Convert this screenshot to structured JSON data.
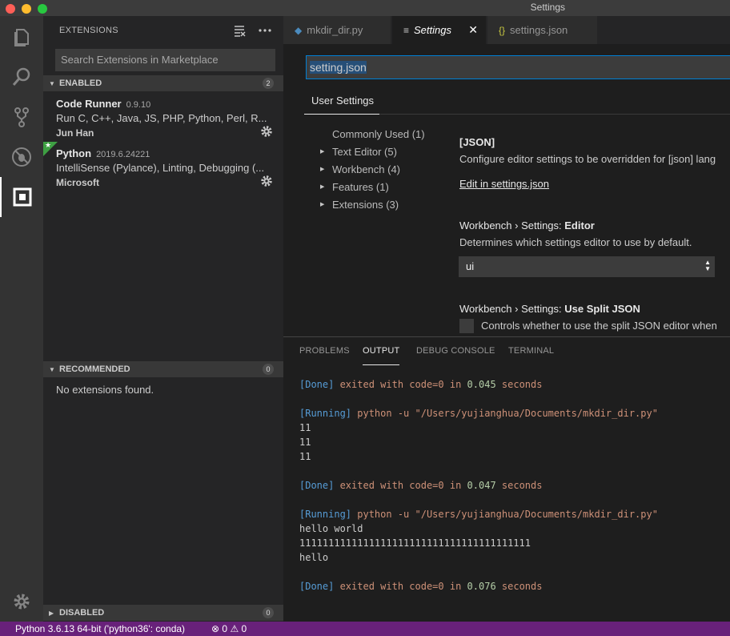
{
  "window": {
    "title": "Settings"
  },
  "sidebar": {
    "header": "EXTENSIONS",
    "search_placeholder": "Search Extensions in Marketplace",
    "enabled": {
      "label": "ENABLED",
      "count": "2",
      "items": [
        {
          "name": "Code Runner",
          "version": "0.9.10",
          "description": "Run C, C++, Java, JS, PHP, Python, Perl, R...",
          "publisher": "Jun Han"
        },
        {
          "name": "Python",
          "version": "2019.6.24221",
          "description": "IntelliSense (Pylance), Linting, Debugging (...",
          "publisher": "Microsoft"
        }
      ]
    },
    "recommended": {
      "label": "RECOMMENDED",
      "count": "0",
      "empty_text": "No extensions found."
    },
    "disabled": {
      "label": "DISABLED",
      "count": "0"
    }
  },
  "tabs": [
    {
      "label": "mkdir_dir.py",
      "icon": "python-file-icon"
    },
    {
      "label": "Settings",
      "icon": "settings-lines-icon",
      "active": true
    },
    {
      "label": "settings.json",
      "icon": "json-braces-icon"
    }
  ],
  "settings": {
    "search_value": "setting.json",
    "scope_tab": "User Settings",
    "toc": [
      {
        "label": "Commonly Used (1)",
        "expandable": false
      },
      {
        "label": "Text Editor (5)",
        "expandable": true
      },
      {
        "label": "Workbench (4)",
        "expandable": true
      },
      {
        "label": "Features (1)",
        "expandable": true
      },
      {
        "label": "Extensions (3)",
        "expandable": true
      }
    ],
    "json_section": {
      "title": "[JSON]",
      "description": "Configure editor settings to be overridden for [json] lang",
      "link": "Edit in settings.json"
    },
    "editor_setting": {
      "prefix": "Workbench › Settings: ",
      "name": "Editor",
      "description": "Determines which settings editor to use by default.",
      "value": "ui"
    },
    "split_setting": {
      "prefix": "Workbench › Settings: ",
      "name": "Use Split JSON",
      "description": "Controls whether to use the split JSON editor when"
    }
  },
  "panel": {
    "tabs": [
      "PROBLEMS",
      "OUTPUT",
      "DEBUG CONSOLE",
      "TERMINAL"
    ],
    "active_tab": "OUTPUT",
    "output": {
      "done1": {
        "tag": "[Done]",
        "text": " exited with ",
        "code": "code=0",
        "in": " in ",
        "secs": "0.045",
        "unit": " seconds"
      },
      "run1": {
        "tag": "[Running]",
        "cmd": " python -u \"/Users/yujianghua/Documents/mkdir_dir.py\""
      },
      "out1": [
        "11",
        "11",
        "11"
      ],
      "done2": {
        "tag": "[Done]",
        "text": " exited with ",
        "code": "code=0",
        "in": " in ",
        "secs": "0.047",
        "unit": " seconds"
      },
      "run2": {
        "tag": "[Running]",
        "cmd": " python -u \"/Users/yujianghua/Documents/mkdir_dir.py\""
      },
      "out2": [
        "hello world",
        "1111111111111111111111111111111111111111",
        "hello"
      ],
      "done3": {
        "tag": "[Done]",
        "text": " exited with ",
        "code": "code=0",
        "in": " in ",
        "secs": "0.076",
        "unit": " seconds"
      }
    }
  },
  "statusbar": {
    "interpreter": "Python 3.6.13 64-bit ('python36': conda)",
    "errors": "0",
    "warnings": "0",
    "color": "#68217a"
  }
}
